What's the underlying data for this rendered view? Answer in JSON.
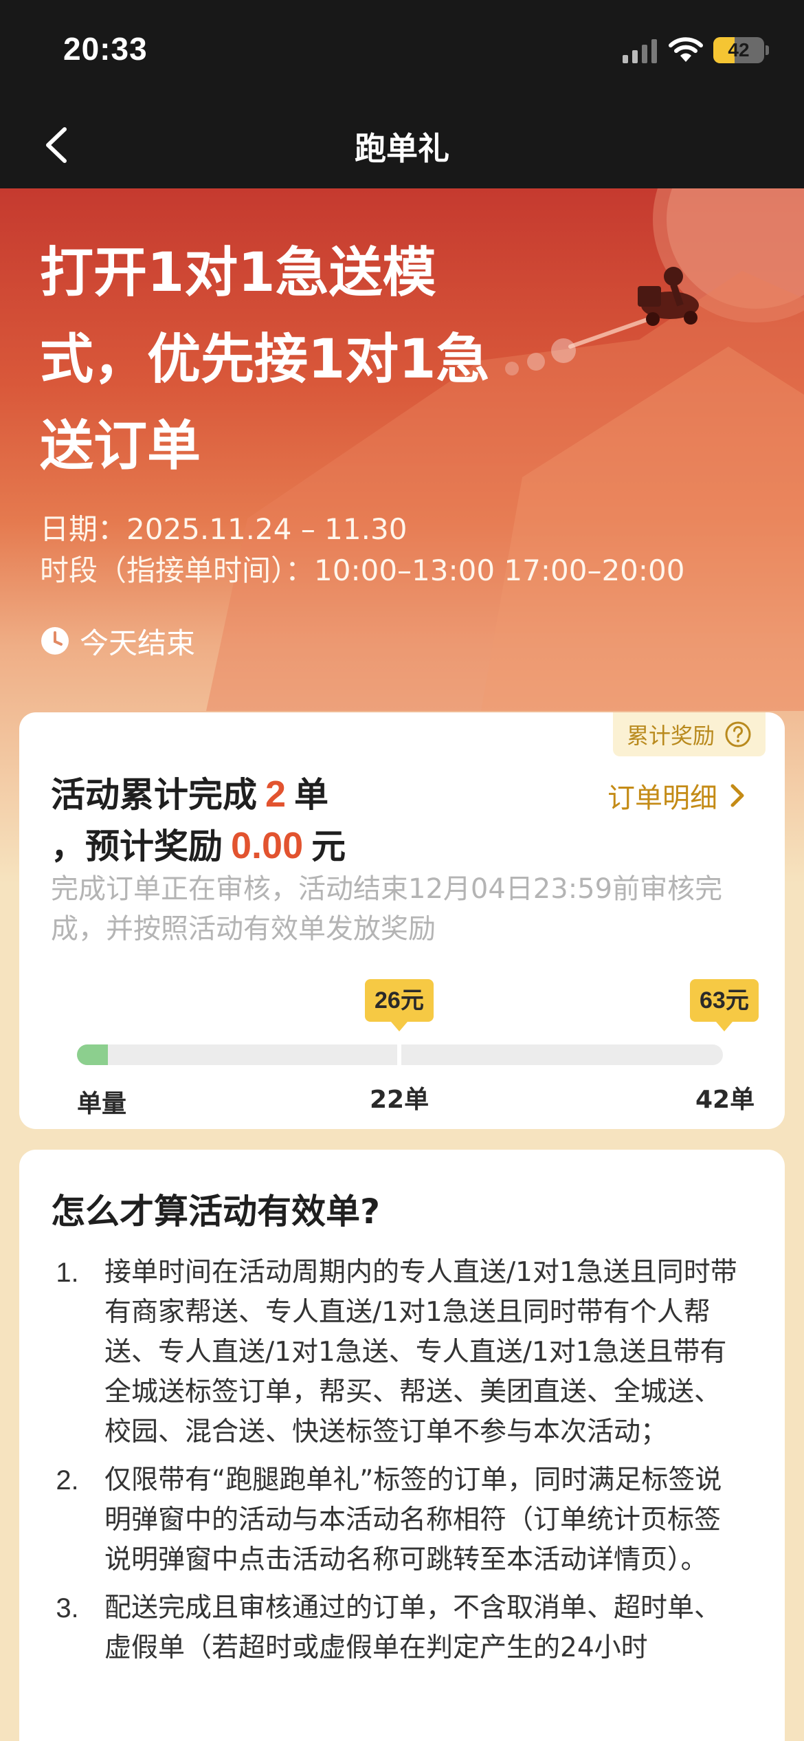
{
  "status_bar": {
    "time": "20:33",
    "battery_percent": 42,
    "battery_label": "42",
    "icons": [
      "signal-icon",
      "wifi-icon",
      "battery-charging-icon"
    ]
  },
  "nav": {
    "title": "跑单礼",
    "back_icon": "chevron-left-icon"
  },
  "hero": {
    "title": "打开1对1急送模式，优先接1对1急送订单",
    "date_line": "日期：2025.11.24 – 11.30",
    "slot_line": "时段（指接单时间）：10:00–13:00 17:00–20:00",
    "countdown": "今天结束"
  },
  "reward": {
    "tag_label": "累计奖励",
    "line1_prefix": "活动累计完成",
    "completed_count": "2",
    "line1_suffix": "单",
    "line2_prefix": "，预计奖励",
    "reward_amount": "0.00",
    "line2_suffix": "元",
    "detail_link": "订单明细",
    "review_note": "完成订单正在审核，活动结束12月04日23:59前审核完成，并按照活动有效单发放奖励",
    "progress": {
      "current_orders": 2,
      "max_orders": 42,
      "axis_title": "单量",
      "milestones": [
        {
          "orders_label": "22单",
          "reward_label": "26元"
        },
        {
          "orders_label": "42单",
          "reward_label": "63元"
        }
      ]
    }
  },
  "rules": {
    "title": "怎么才算活动有效单?",
    "items": [
      {
        "num": "1.",
        "text": "接单时间在活动周期内的专人直送/1对1急送且同时带有商家帮送、专人直送/1对1急送且同时带有个人帮送、专人直送/1对1急送、专人直送/1对1急送且带有全城送标签订单，帮买、帮送、美团直送、全城送、校园、混合送、快送标签订单不参与本次活动；"
      },
      {
        "num": "2.",
        "text": "仅限带有“跑腿跑单礼”标签的订单，同时满足标签说明弹窗中的活动与本活动名称相符（订单统计页标签说明弹窗中点击活动名称可跳转至本活动详情页）。"
      },
      {
        "num": "3.",
        "text": "配送完成且审核通过的订单，不含取消单、超时单、虚假单（若超时或虚假单在判定产生的24小时"
      }
    ]
  }
}
